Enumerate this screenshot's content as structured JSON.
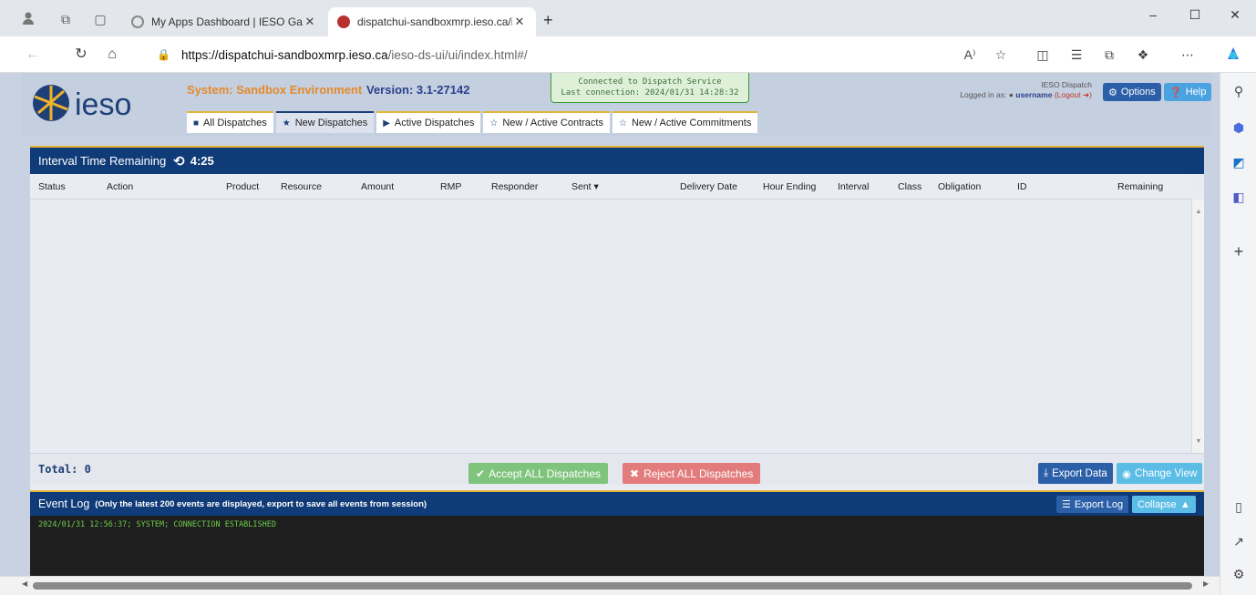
{
  "browser": {
    "tabs": [
      {
        "title": "My Apps Dashboard | IESO Gatew",
        "active": false
      },
      {
        "title": "dispatchui-sandboxmrp.ieso.ca/ie",
        "active": true
      }
    ],
    "url_host": "https://dispatchui-sandboxmrp.ieso.ca",
    "url_path": "/ieso-ds-ui/ui/index.html#/",
    "reading_label": "A⁾"
  },
  "app": {
    "logo_text": "ieso",
    "system": "System: Sandbox Environment",
    "version": "Version: 3.1-27142",
    "connection": {
      "line1": "Connected to Dispatch Service",
      "line2": "Last connection: 2024/01/31 14:28:32"
    },
    "login": {
      "role": "IESO Dispatch",
      "prefix": "Logged in as:",
      "username": "username",
      "logout": "(Logout"
    },
    "options_label": "Options",
    "help_label": "Help",
    "tabs": [
      {
        "label": "All Dispatches",
        "icon": "grid-icon"
      },
      {
        "label": "New Dispatches",
        "icon": "star-icon"
      },
      {
        "label": "Active Dispatches",
        "icon": "play-icon"
      },
      {
        "label": "New / Active Contracts",
        "icon": "star-outline-icon"
      },
      {
        "label": "New / Active Commitments",
        "icon": "star-outline-icon"
      }
    ]
  },
  "interval": {
    "label": "Interval Time Remaining",
    "time": "4:25"
  },
  "table": {
    "columns": [
      "Status",
      "Action",
      "Product",
      "Resource",
      "Amount",
      "RMP",
      "Responder",
      "Sent ▾",
      "Delivery Date",
      "Hour Ending",
      "Interval",
      "Class",
      "Obligation",
      "ID",
      "Remaining"
    ],
    "rows": []
  },
  "footer": {
    "total": "Total: 0",
    "accept_label": "Accept ALL Dispatches",
    "reject_label": "Reject ALL Dispatches",
    "export_label": "Export Data",
    "change_view_label": "Change View"
  },
  "event_log": {
    "title": "Event Log",
    "note": "(Only the latest 200 events are displayed, export to save all events from session)",
    "export_label": "Export Log",
    "collapse_label": "Collapse",
    "entries": [
      "2024/01/31 12:56:37; SYSTEM; CONNECTION ESTABLISHED"
    ]
  },
  "colors": {
    "navy": "#0f3b78",
    "gold": "#e5b53a",
    "accept": "#7fc47c",
    "reject": "#e27c7c",
    "console_text": "#6ecb4a"
  }
}
